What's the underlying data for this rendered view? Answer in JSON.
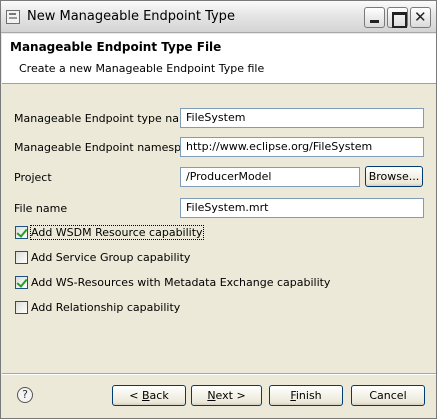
{
  "window": {
    "title": "New Manageable Endpoint Type",
    "close_glyph": "✕"
  },
  "banner": {
    "title": "Manageable Endpoint Type File",
    "description": "Create a new Manageable Endpoint Type file"
  },
  "form": {
    "type_name": {
      "label": "Manageable Endpoint type name",
      "value": "FileSystem"
    },
    "namespace": {
      "label": "Manageable Endpoint namespace",
      "value": "http://www.eclipse.org/FileSystem"
    },
    "project": {
      "label": "Project",
      "value": "/ProducerModel",
      "browse_label": "Browse..."
    },
    "file_name": {
      "label": "File name",
      "value": "FileSystem.mrt"
    }
  },
  "capabilities": [
    {
      "label": "Add WSDM Resource capability",
      "checked": true
    },
    {
      "label": "Add Service Group capability",
      "checked": false
    },
    {
      "label": "Add WS-Resources with Metadata Exchange capability",
      "checked": true
    },
    {
      "label": "Add Relationship capability",
      "checked": false
    }
  ],
  "footer": {
    "help_glyph": "?",
    "back_prefix": "< ",
    "back_mnemonic": "B",
    "back_rest": "ack",
    "next_mnemonic": "N",
    "next_rest": "ext >",
    "finish_mnemonic": "F",
    "finish_rest": "inish",
    "cancel_label": "Cancel"
  }
}
